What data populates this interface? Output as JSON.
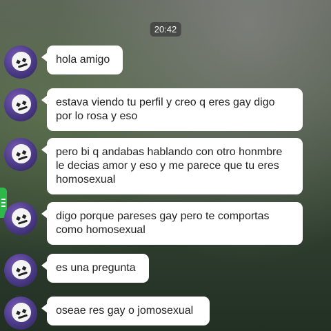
{
  "chat": {
    "timestamp": "20:42",
    "messages": [
      {
        "text": "hola amigo"
      },
      {
        "text": "estava viendo tu perfil y creo q eres gay digo por lo rosa y eso"
      },
      {
        "text": "pero bi q andabas hablando con otro honmbre le decias amor y eso y me parece que tu eres homosexual"
      },
      {
        "text": "digo porque pareses gay pero te comportas como homosexual"
      },
      {
        "text": "es una pregunta"
      },
      {
        "text": "oseae res gay o jomosexual"
      }
    ]
  },
  "colors": {
    "bubble": "#ffffff",
    "side_tab": "#2fb84a"
  },
  "icons": {
    "avatar": "marshmello-avatar",
    "side_tab": "menu-lines-icon"
  }
}
